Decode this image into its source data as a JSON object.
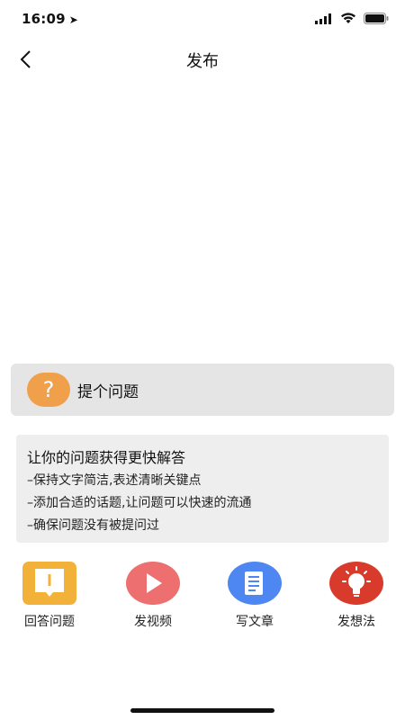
{
  "status_bar": {
    "time": "16:09"
  },
  "nav": {
    "title": "发布"
  },
  "ask": {
    "label": "提个问题",
    "icon_char": "?"
  },
  "tips": {
    "title": "让你的问题获得更快解答",
    "lines": [
      "–保持文字简洁,表述清晰关键点",
      "–添加合适的话题,让问题可以快速的流通",
      "–确保问题没有被提问过"
    ]
  },
  "actions": [
    {
      "label": "回答问题",
      "icon": "answer-icon",
      "color": "#f2b23a"
    },
    {
      "label": "发视频",
      "icon": "video-play-icon",
      "color": "#ee6f6f"
    },
    {
      "label": "写文章",
      "icon": "article-icon",
      "color": "#4e86f2"
    },
    {
      "label": "发想法",
      "icon": "idea-bulb-icon",
      "color": "#d83a2c"
    }
  ]
}
